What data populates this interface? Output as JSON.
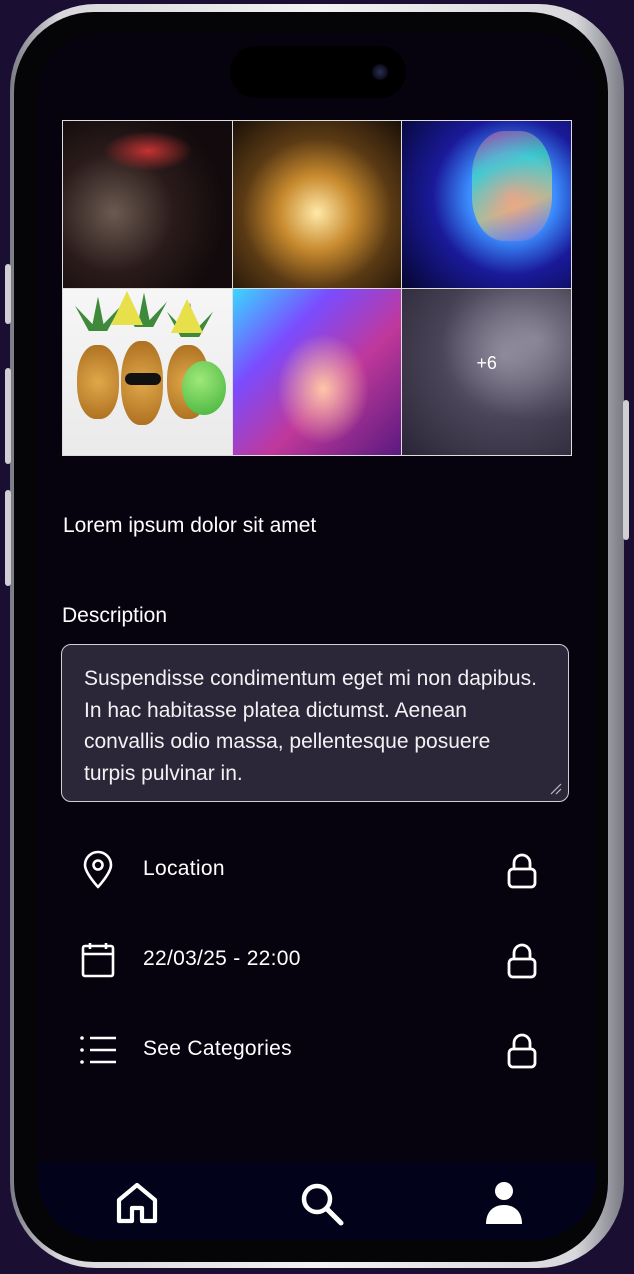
{
  "gallery": {
    "images": [
      {
        "alt": "party-crowd-photo"
      },
      {
        "alt": "concert-confetti-photo"
      },
      {
        "alt": "neon-dancer-photo"
      },
      {
        "alt": "pineapples-party-photo"
      },
      {
        "alt": "dance-floor-photo"
      },
      {
        "alt": "smoky-party-photo"
      }
    ],
    "more_count": "+6"
  },
  "event": {
    "title": "Lorem ipsum dolor sit amet"
  },
  "description": {
    "label": "Description",
    "text": "Suspendisse condimentum eget mi non dapibus. In hac habitasse platea dictumst. Aenean convallis odio massa, pellentesque posuere turpis pulvinar in."
  },
  "details": [
    {
      "icon": "map-pin-icon",
      "label": "Location",
      "locked": true
    },
    {
      "icon": "calendar-icon",
      "label": "22/03/25 - 22:00",
      "locked": true
    },
    {
      "icon": "list-icon",
      "label": "See Categories",
      "locked": true
    }
  ],
  "nav": {
    "items": [
      {
        "icon": "home-icon",
        "name": "home"
      },
      {
        "icon": "search-icon",
        "name": "search"
      },
      {
        "icon": "profile-icon",
        "name": "profile"
      }
    ]
  },
  "colors": {
    "background": "#06030f",
    "textbox": "#2c2738",
    "nav": "#02031a",
    "text": "#ffffff"
  }
}
